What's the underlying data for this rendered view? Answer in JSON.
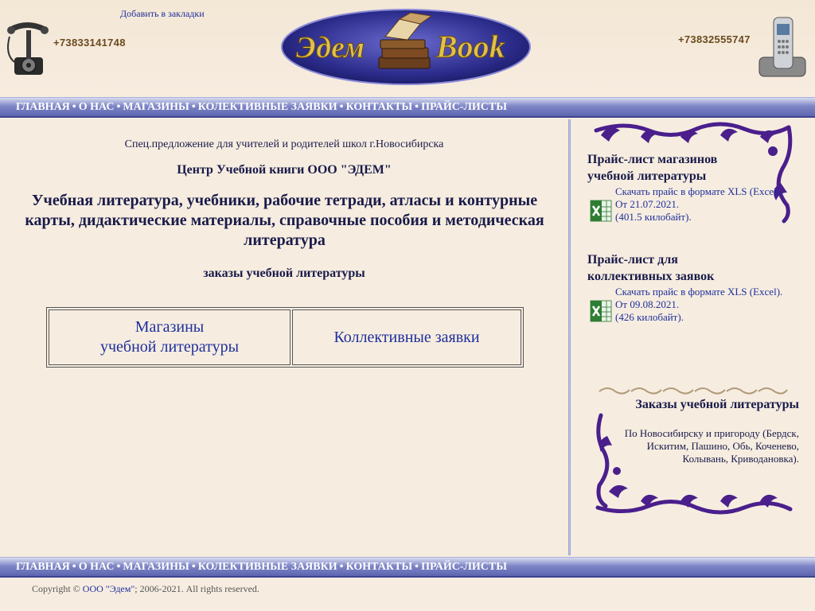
{
  "header": {
    "bookmark": "Добавить в закладки",
    "phone_left": "+73833141748",
    "phone_right": "+73832555747",
    "logo_text_left": "Эдем",
    "logo_text_right": "Book"
  },
  "nav": {
    "items": [
      "ГЛАВНАЯ",
      "О НАС",
      "МАГАЗИНЫ",
      "КОЛЕКТИВНЫЕ ЗАЯВКИ",
      "КОНТАКТЫ",
      "ПРАЙС-ЛИСТЫ"
    ],
    "separator": "•"
  },
  "main": {
    "spec_offer": "Спец.предложение для учителей и родителей школ г.Новосибирска",
    "center_title": "Центр Учебной книги ООО \"ЭДЕМ\"",
    "headline": "Учебная литература, учебники, рабочие тетради, атласы и контурные карты, дидактические материалы, справочные пособия и методическая литература",
    "orders_subtitle": "заказы учебной литературы",
    "choice_shops_line1": "Магазины",
    "choice_shops_line2": "учебной литературы",
    "choice_collective": "Коллективные заявки"
  },
  "sidebar": {
    "price1": {
      "title": "Прайс-лист магазинов учебной литературы",
      "link": "Скачать прайс в формате XLS (Excel).",
      "date": "От 21.07.2021.",
      "size": "(401.5 килобайт)."
    },
    "price2": {
      "title": "Прайс-лист для коллективных заявок",
      "link": "Скачать прайс в формате XLS (Excel).",
      "date": "От 09.08.2021.",
      "size": "(426 килобайт)."
    },
    "orders_title": "Заказы учебной литературы",
    "orders_text": "По Новосибирску и пригороду (Бердск, Искитим, Пашино, Обь, Коченево, Колывань, Криводановка)."
  },
  "footer": {
    "copyright_prefix": "Copyright ©",
    "brand": "ООО \"Эдем\"",
    "copyright_suffix": "; 2006-2021. All rights reserved."
  },
  "colors": {
    "background": "#f6ede0",
    "nav_blue": "#5d65b0",
    "link_blue": "#1f2f9c",
    "ornament_purple": "#4a1f8c",
    "phone_brown": "#6b4a1e"
  },
  "icons": [
    "retro-telephone-icon",
    "cell-phone-icon",
    "excel-file-icon",
    "book-stack-icon"
  ]
}
